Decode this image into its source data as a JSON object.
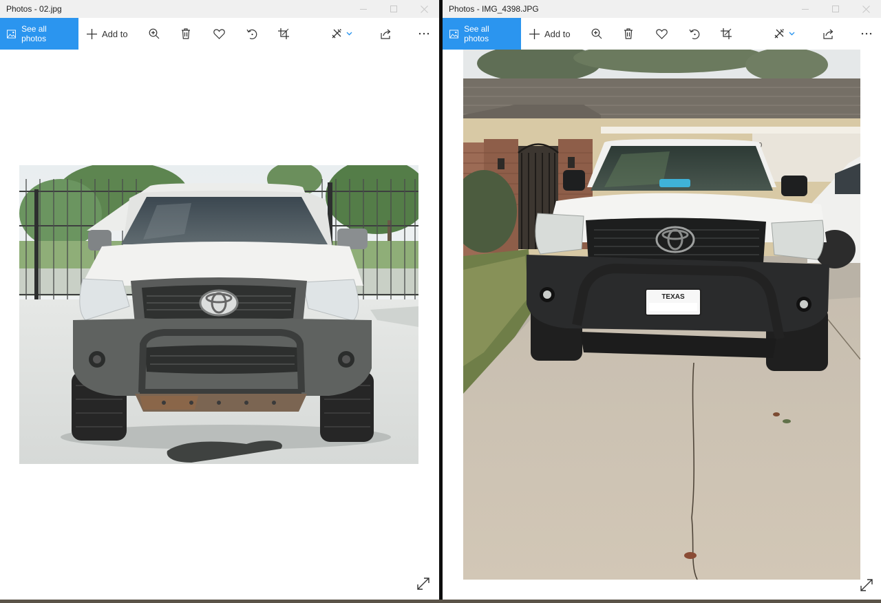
{
  "left_window": {
    "title": "Photos - 02.jpg",
    "toolbar": {
      "see_all_label": "See all photos",
      "add_to_label": "Add to"
    }
  },
  "right_window": {
    "title": "Photos - IMG_4398.JPG",
    "toolbar": {
      "see_all_label": "See all photos",
      "add_to_label": "Add to"
    },
    "plate_text": "TEXAS",
    "sign_text": "1430"
  },
  "colors": {
    "accent": "#2b95ef",
    "titlebar_bg": "#f0f0f0",
    "truck_white": "#f3f3f1",
    "bumper_gray": "#5f6260",
    "bumper_black": "#2a2b2c"
  },
  "icons": [
    "picture-icon",
    "plus-icon",
    "zoom-in-icon",
    "trash-icon",
    "heart-icon",
    "rotate-icon",
    "crop-icon",
    "edit-create-icon",
    "chevron-down-icon",
    "share-icon",
    "more-icon",
    "expand-icon"
  ]
}
